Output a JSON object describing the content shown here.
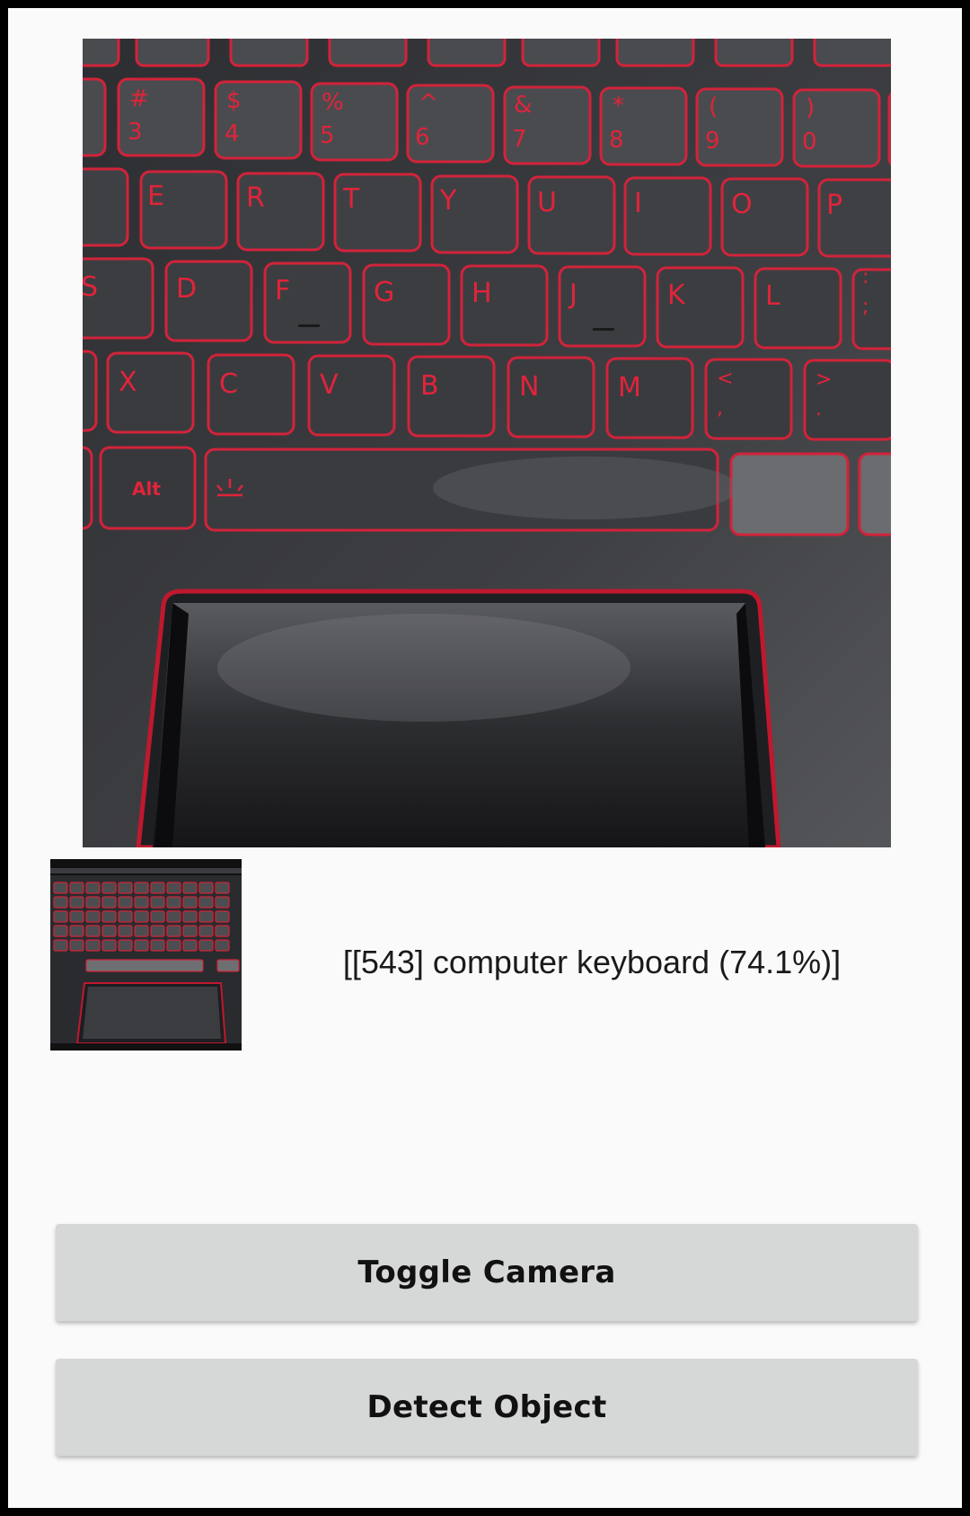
{
  "detection": {
    "result": "[[543] computer keyboard (74.1%)]"
  },
  "preview": {
    "key_labels": [
      "#",
      "3",
      "$",
      "4",
      "%",
      "5",
      "^",
      "6",
      "&",
      "7",
      "*",
      "8",
      "(",
      "9",
      ")",
      "0",
      "E",
      "R",
      "T",
      "Y",
      "U",
      "I",
      "O",
      "P",
      "S",
      "D",
      "F",
      "G",
      "H",
      "J",
      "K",
      "L",
      ":",
      ";",
      "X",
      "C",
      "V",
      "B",
      "N",
      "M",
      "<",
      ",",
      ">",
      ".",
      "Alt"
    ]
  },
  "buttons": {
    "toggle_camera": "Toggle Camera",
    "detect_object": "Detect Object"
  },
  "colors": {
    "key_backlight": "#e0243a",
    "button_bg": "#d6d7d7",
    "screen_bg": "#fafafa"
  }
}
